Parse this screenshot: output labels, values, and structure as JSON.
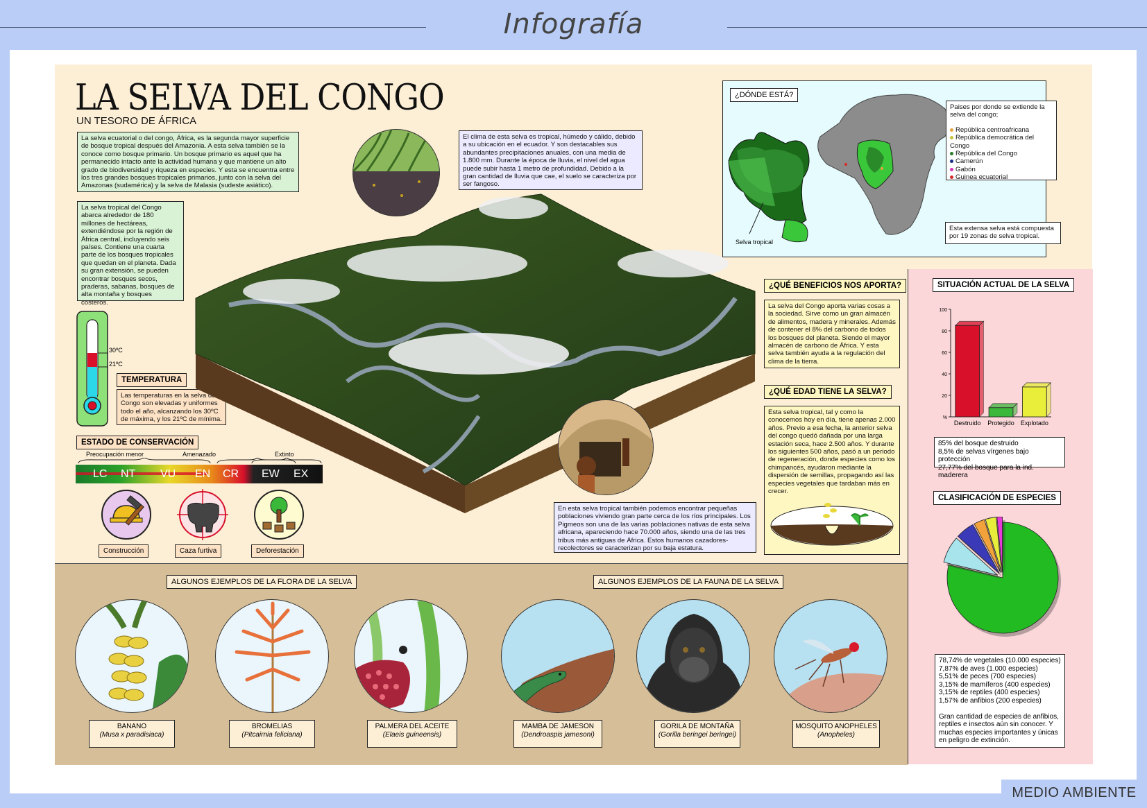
{
  "header": {
    "title": "Infografía"
  },
  "main": {
    "title": "LA SELVA DEL CONGO",
    "subtitle": "UN TESORO DE ÁFRICA",
    "intro_text": "La selva ecuatorial o del congo, África, es la segunda mayor superficie de bosque tropical después del Amazonia. A esta selva también se la conoce como bosque primario. Un bosque primario es aquel que ha permanecido intacto ante la actividad humana y que mantiene un alto grado de biodiversidad y riqueza en especies. Y esta se encuentra entre los tres grandes bosques tropicales primarios, junto con la selva del Amazonas (sudamérica) y la selva de Malasia (sudeste asiático).",
    "extent_text": "La selva tropical del Congo abarca alrededor de 180 millones de hectáreas, extendiéndose por la región de África central, incluyendo seis países. Contiene una cuarta parte de los bosques tropicales que quedan en el planeta. Dada su gran extensión, se pueden encontrar bosques secos, praderas, sabanas, bosques de alta montaña y bosques costeros.",
    "climate_text": "El clima de esta selva es tropical, húmedo y cálido, debido a su ubicación en el ecuador. Y son destacables sus abundantes precipitaciones anuales, con una media de 1.800 mm. Durante la época de lluvia, el nivel del agua puede subir hasta 1 metro de profundidad. Debido a la gran cantidad de lluvia que cae, el suelo se caracteriza por ser fangoso.",
    "pygmy_text": "En esta selva tropical también podemos encontrar pequeñas poblaciones viviendo gran parte cerca de los ríos principales. Los Pigmeos son una de las varias poblaciones nativas de esta selva africana, apareciendo hace 70.000 años, siendo una de las tres tribus más antiguas de África. Estos humanos cazadores-recolectores se caracterizan por su baja estatura."
  },
  "temperature": {
    "high_label": "30ºC",
    "low_label": "21ºC",
    "title": "TEMPERATURA",
    "text": "Las temperaturas en la selva del Congo son elevadas y uniformes todo el año, alcanzando los 30ºC de máxima, y los 21ºC de mínima."
  },
  "conservation": {
    "title": "ESTADO DE CONSERVACIÓN",
    "groups": [
      "Preocupación menor",
      "Amenazado",
      "Extinto"
    ],
    "codes": [
      "LC",
      "NT",
      "VU",
      "EN",
      "CR",
      "EW",
      "EX"
    ],
    "threats": [
      "Construcción",
      "Caza furtiva",
      "Deforestación"
    ]
  },
  "map": {
    "title": "¿DÓNDE ESTÁ?",
    "rainforest_label": "Selva tropical",
    "countries_intro": "Paises por donde se extiende la selva del congo;",
    "countries": [
      {
        "name": "República centroafricana",
        "color": "#e8a23a"
      },
      {
        "name": "República democrática del Congo",
        "color": "#c8c23a"
      },
      {
        "name": "República del Congo",
        "color": "#2a7a2a"
      },
      {
        "name": "Camerún",
        "color": "#1a2a8a"
      },
      {
        "name": "Gabón",
        "color": "#d832b8"
      },
      {
        "name": "Guinea ecuatorial",
        "color": "#d82a2a"
      }
    ],
    "zones_text": "Esta extensa selva está compuesta por 19 zonas de selva tropical."
  },
  "benefits": {
    "title": "¿QUÉ BENEFICIOS NOS APORTA?",
    "text": "La selva del Congo aporta varias cosas a la sociedad. Sirve como un gran almacén de alimentos, madera y minerales. Además de contener el 8% del carbono de todos los bosques del planeta. Siendo el mayor almacén de carbono de África. Y esta selva también ayuda a la regulación del clima de la tierra."
  },
  "age": {
    "title": "¿QUÉ EDAD TIENE LA SELVA?",
    "text": "Esta selva tropical, tal y como la conocemos hoy en día, tiene apenas 2.000 años. Previo a esa fecha, la anterior selva del congo quedó dañada por una larga estación seca, hace 2.500 años. Y durante los siguientes 500 años, pasó a un periodo de regeneración, donde especies como los chimpancés, ayudaron mediante la dispersión de semillas, propagando así las especies vegetales que tardaban más en crecer."
  },
  "situation": {
    "title": "SITUACIÓN ACTUAL DE LA SELVA",
    "stats": [
      "85% del bosque destruido",
      "8,5% de selvas vírgenes bajo protección",
      "27,77% del bosque para la ind. maderera"
    ]
  },
  "classification": {
    "title": "CLASIFICACIÓN DE ESPECIES",
    "stats": [
      "78,74% de vegetales (10.000 especies)",
      "7,87% de aves (1.000 especies)",
      "5,51% de peces (700 especies)",
      "3,15% de mamíferos (400 especies)",
      "3,15% de reptiles (400 especies)",
      "1,57% de anfibios (200 especies)"
    ],
    "note": "Gran cantidad de especies de anfibios, reptiles e insectos aún sin conocer. Y muchas especies importantes y únicas en peligro de extinción."
  },
  "chart_data": [
    {
      "type": "bar",
      "categories": [
        "Destruido",
        "Protegido",
        "Explotado"
      ],
      "values": [
        85,
        8.5,
        27.77
      ],
      "colors": [
        "#d8102a",
        "#3cb83c",
        "#e8ee3a"
      ],
      "ylim": [
        0,
        100
      ],
      "yticks": [
        0,
        20,
        40,
        60,
        80,
        100
      ],
      "ytick_labels": [
        "%",
        "20",
        "40",
        "60",
        "80",
        "100"
      ]
    },
    {
      "type": "pie",
      "categories": [
        "vegetales",
        "aves",
        "peces",
        "mamíferos",
        "reptiles",
        "anfibios"
      ],
      "values": [
        78.74,
        7.87,
        5.51,
        3.15,
        3.15,
        1.57
      ],
      "colors": [
        "#22bb22",
        "#a8e4ec",
        "#3a3ab8",
        "#f2a23a",
        "#e8ec3a",
        "#e83ad8"
      ]
    }
  ],
  "flora": {
    "title": "ALGUNOS EJEMPLOS DE LA FLORA DE LA SELVA",
    "items": [
      {
        "name": "BANANO",
        "latin": "(Musa x paradisiaca)"
      },
      {
        "name": "BROMELIAS",
        "latin": "(Pitcairnia feliciana)"
      },
      {
        "name": "PALMERA DEL ACEITE",
        "latin": "(Elaeis guineensis)"
      }
    ]
  },
  "fauna": {
    "title": "ALGUNOS EJEMPLOS DE LA FAUNA DE LA SELVA",
    "items": [
      {
        "name": "MAMBA DE JAMESON",
        "latin": "(Dendroaspis jamesoni)"
      },
      {
        "name": "GORILA DE MONTAÑA",
        "latin": "(Gorilla beringei beringei)"
      },
      {
        "name": "MOSQUITO ANOPHELES",
        "latin": "(Anopheles)"
      }
    ]
  },
  "footer": {
    "tag": "MEDIO AMBIENTE"
  }
}
